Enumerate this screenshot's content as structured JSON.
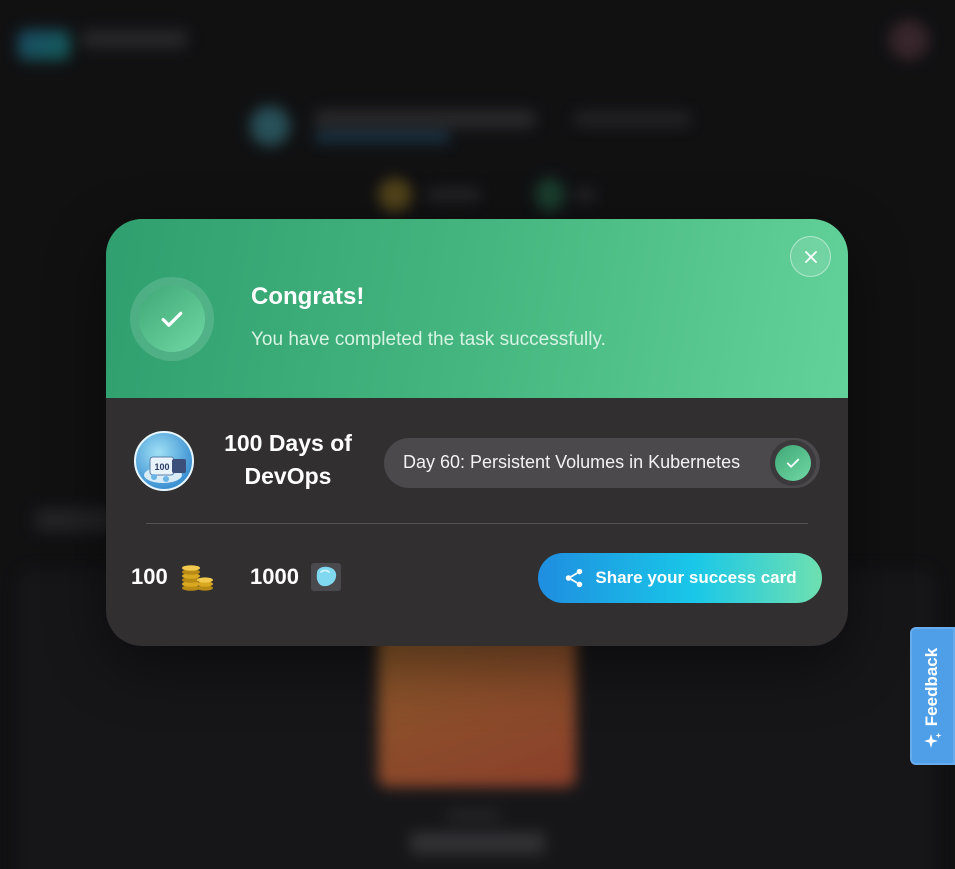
{
  "modal": {
    "title": "Congrats!",
    "subtitle": "You have completed the task successfully.",
    "course_title": "100 Days of DevOps",
    "course_badge_text": "100",
    "task_label": "Day 60: Persistent Volumes in Kubernetes",
    "coins_value": "100",
    "gems_value": "1000",
    "share_label": "Share your success card"
  },
  "feedback": {
    "label": "Feedback"
  },
  "colors": {
    "success_green": "#3fa876",
    "share_gradient_start": "#1f8ee0",
    "share_gradient_end": "#6fe0b0",
    "feedback_blue": "#4f9ee8",
    "modal_body": "#312f30"
  },
  "icons": {
    "header_check": "check-icon",
    "close": "close-icon",
    "task_status": "check-icon",
    "coins": "coins-icon",
    "gems": "gem-icon",
    "share": "share-icon",
    "feedback": "sparkle-icon"
  }
}
